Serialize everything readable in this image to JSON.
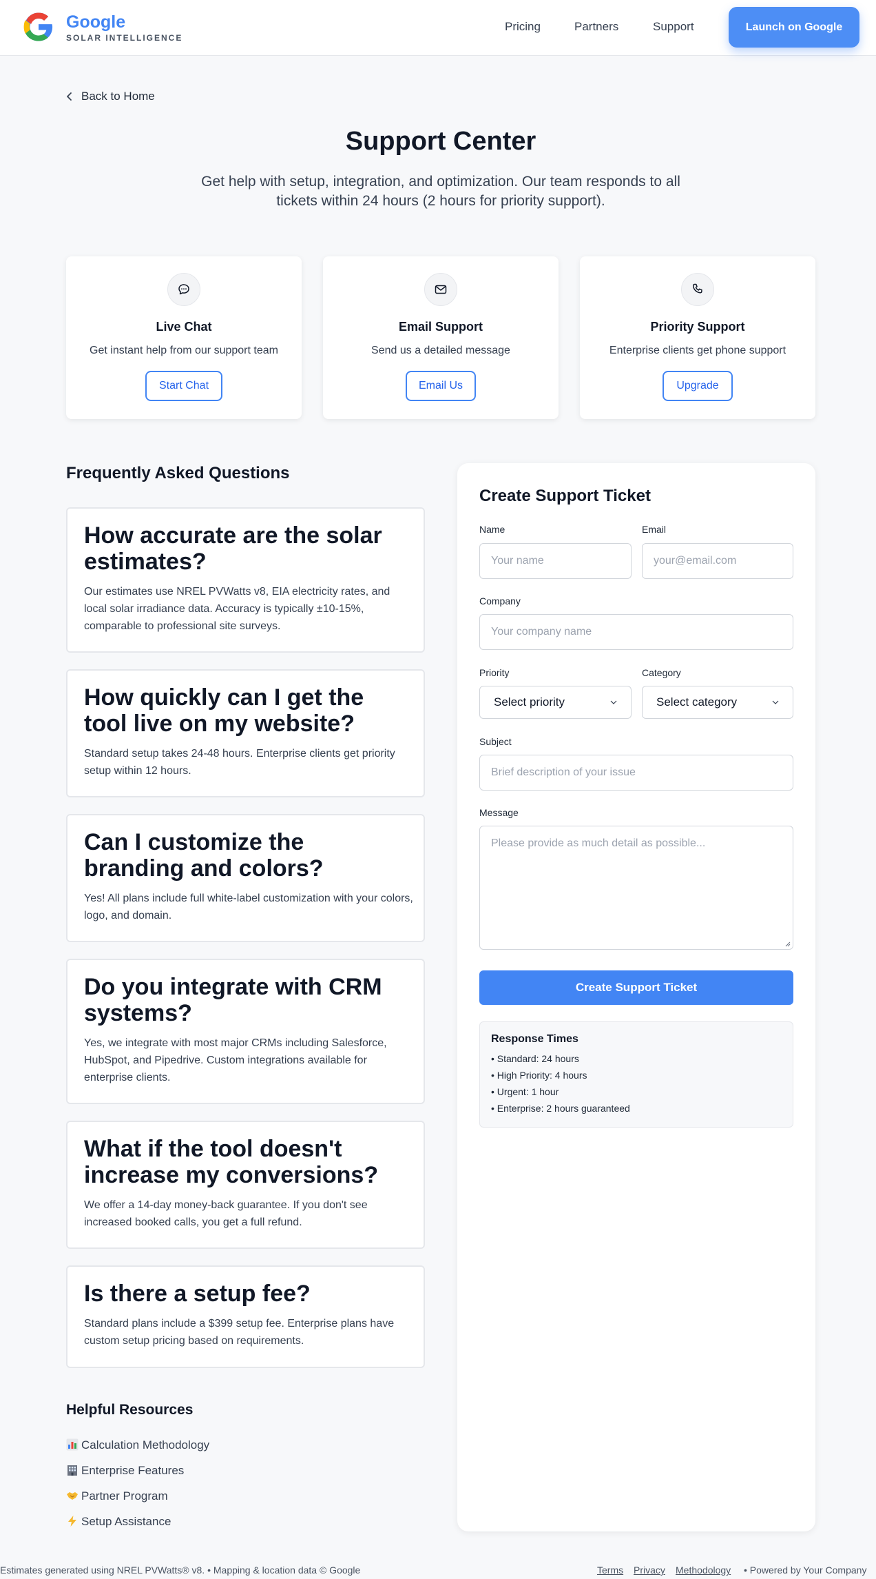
{
  "header": {
    "brand_name": "Google",
    "brand_sub": "SOLAR INTELLIGENCE",
    "nav": [
      "Pricing",
      "Partners",
      "Support"
    ],
    "launch_label": "Launch on Google"
  },
  "back_label": "Back to Home",
  "page": {
    "title": "Support Center",
    "subtitle": "Get help with setup, integration, and optimization. Our team responds to all tickets within 24 hours (2 hours for priority support)."
  },
  "cards": [
    {
      "title": "Live Chat",
      "desc": "Get instant help from our support team",
      "button": "Start Chat",
      "icon": "chat-icon"
    },
    {
      "title": "Email Support",
      "desc": "Send us a detailed message",
      "button": "Email Us",
      "icon": "mail-icon"
    },
    {
      "title": "Priority Support",
      "desc": "Enterprise clients get phone support",
      "button": "Upgrade",
      "icon": "phone-icon"
    }
  ],
  "faq": {
    "heading": "Frequently Asked Questions",
    "items": [
      {
        "q": "How accurate are the solar estimates?",
        "a": "Our estimates use NREL PVWatts v8, EIA electricity rates, and local solar irradiance data. Accuracy is typically ±10-15%, comparable to professional site surveys."
      },
      {
        "q": "How quickly can I get the tool live on my website?",
        "a": "Standard setup takes 24-48 hours. Enterprise clients get priority setup within 12 hours."
      },
      {
        "q": "Can I customize the branding and colors?",
        "a": "Yes! All plans include full white-label customization with your colors, logo, and domain."
      },
      {
        "q": "Do you integrate with CRM systems?",
        "a": "Yes, we integrate with most major CRMs including Salesforce, HubSpot, and Pipedrive. Custom integrations available for enterprise clients."
      },
      {
        "q": "What if the tool doesn't increase my conversions?",
        "a": "We offer a 14-day money-back guarantee. If you don't see increased booked calls, you get a full refund."
      },
      {
        "q": "Is there a setup fee?",
        "a": "Standard plans include a $399 setup fee. Enterprise plans have custom setup pricing based on requirements."
      }
    ]
  },
  "resources": {
    "heading": "Helpful Resources",
    "items": [
      {
        "label": "Calculation Methodology",
        "icon": "bar-chart-icon"
      },
      {
        "label": "Enterprise Features",
        "icon": "building-icon"
      },
      {
        "label": "Partner Program",
        "icon": "handshake-icon"
      },
      {
        "label": "Setup Assistance",
        "icon": "lightning-icon"
      }
    ]
  },
  "ticket": {
    "title": "Create Support Ticket",
    "name_label": "Name",
    "name_placeholder": "Your name",
    "email_label": "Email",
    "email_placeholder": "your@email.com",
    "company_label": "Company",
    "company_placeholder": "Your company name",
    "priority_label": "Priority",
    "priority_value": "Select priority",
    "category_label": "Category",
    "category_value": "Select category",
    "subject_label": "Subject",
    "subject_placeholder": "Brief description of your issue",
    "message_label": "Message",
    "message_placeholder": "Please provide as much detail as possible...",
    "submit_label": "Create Support Ticket",
    "response": {
      "title": "Response Times",
      "lines": [
        "• Standard: 24 hours",
        "• High Priority: 4 hours",
        "• Urgent: 1 hour",
        "• Enterprise: 2 hours guaranteed"
      ]
    }
  },
  "footer": {
    "left": "Estimates generated using NREL PVWatts® v8.  •  Mapping & location data © Google",
    "links": [
      "Terms",
      "Privacy",
      "Methodology"
    ],
    "right": "•   Powered by Your Company"
  },
  "colors": {
    "accent": "#4285f4",
    "background": "#f7f8fa"
  }
}
